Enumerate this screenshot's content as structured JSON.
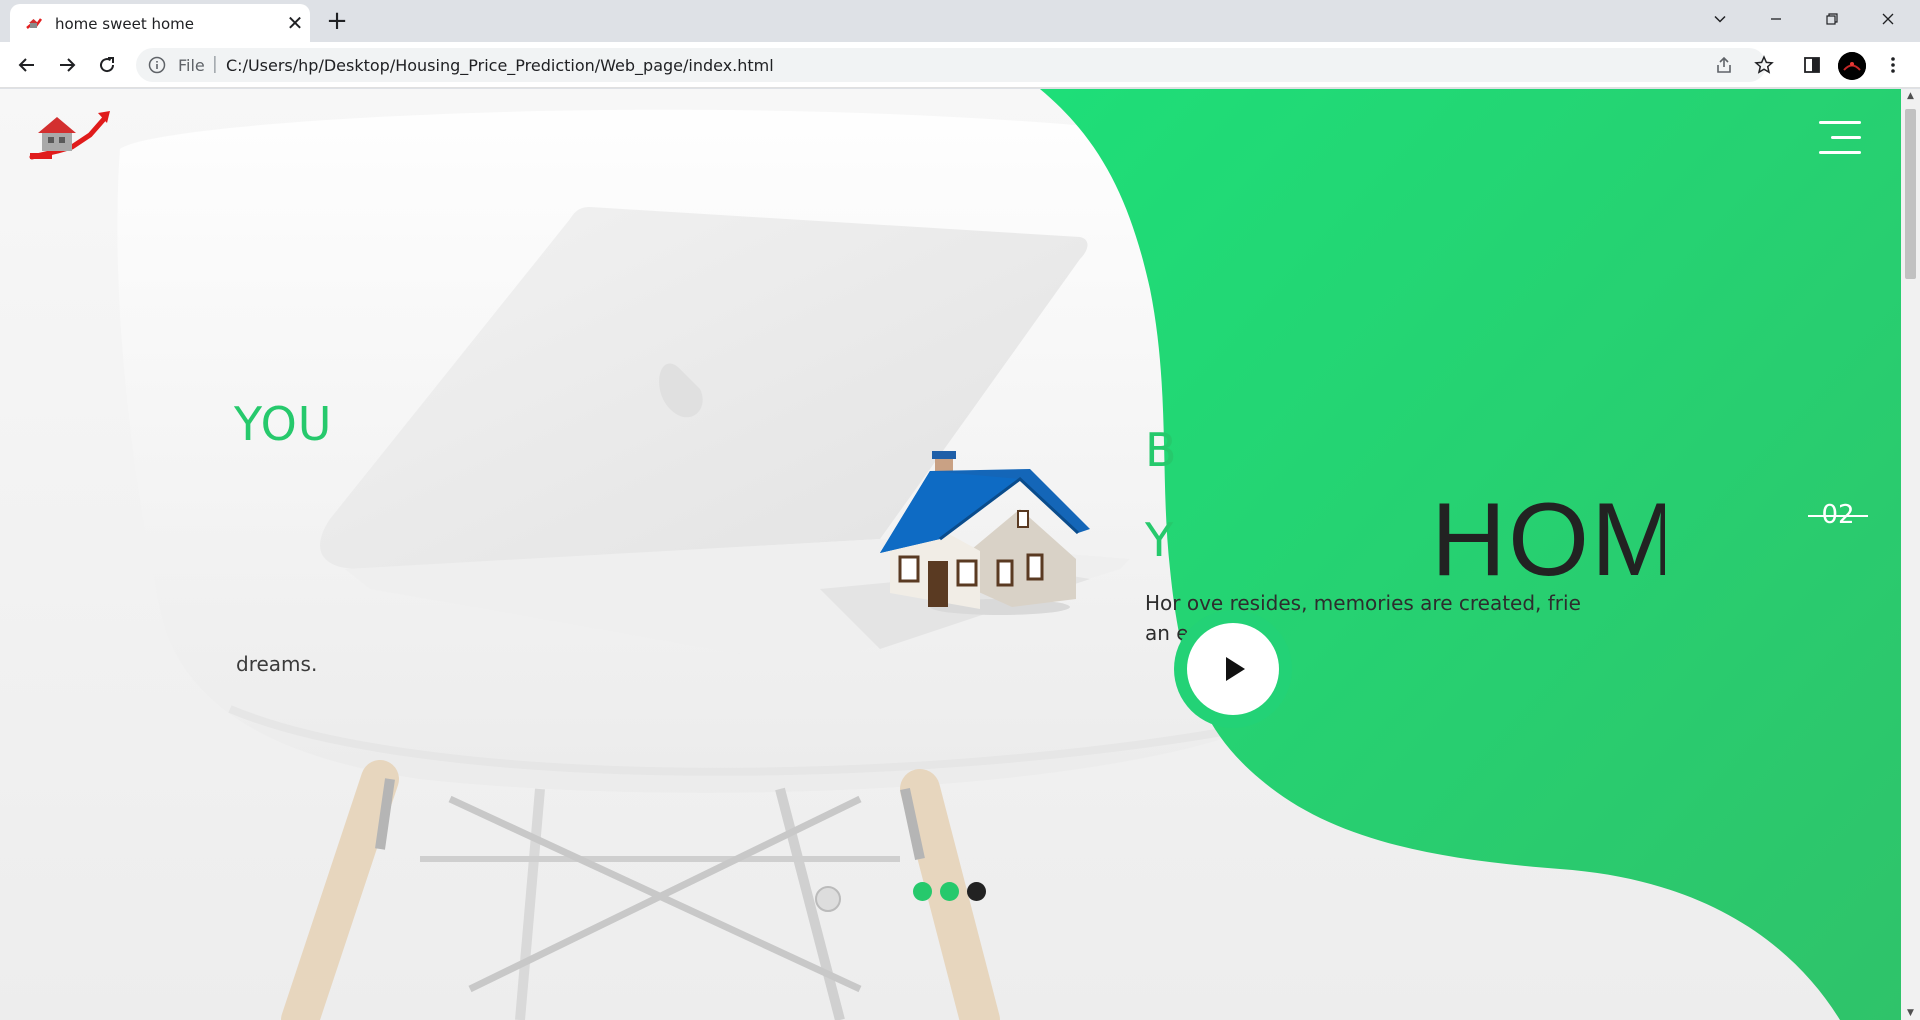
{
  "browser": {
    "tab_title": "home sweet home",
    "tab_close": "✕",
    "new_tab": "+",
    "address_scheme": "File",
    "address_separator": "|",
    "url": "C:/Users/hp/Desktop/Housing_Price_Prediction/Web_page/index.html"
  },
  "page": {
    "left_slide": {
      "heading": "YOU",
      "text": "dreams."
    },
    "center_slide": {
      "heading_line1": "B",
      "heading_line2": "Y",
      "big_title": "HOM",
      "text_line1": "Hor                    ove resides, memories are created, frie",
      "text_line2": "an                       er ends."
    },
    "slide_number": "02",
    "pagination_dots": [
      {
        "color": "#26c96c",
        "active": false
      },
      {
        "color": "#26c96c",
        "active": false
      },
      {
        "color": "#222222",
        "active": true
      }
    ]
  },
  "colors": {
    "accent_green": "#23d276",
    "text_dark": "#222222"
  },
  "icons": [
    "back-arrow-icon",
    "forward-arrow-icon",
    "reload-icon",
    "info-icon",
    "share-icon",
    "star-icon",
    "side-panel-icon",
    "kebab-menu-icon",
    "chevron-down-icon",
    "minimize-icon",
    "restore-icon",
    "close-icon",
    "hamburger-menu-icon",
    "play-icon",
    "house-logo-icon"
  ]
}
